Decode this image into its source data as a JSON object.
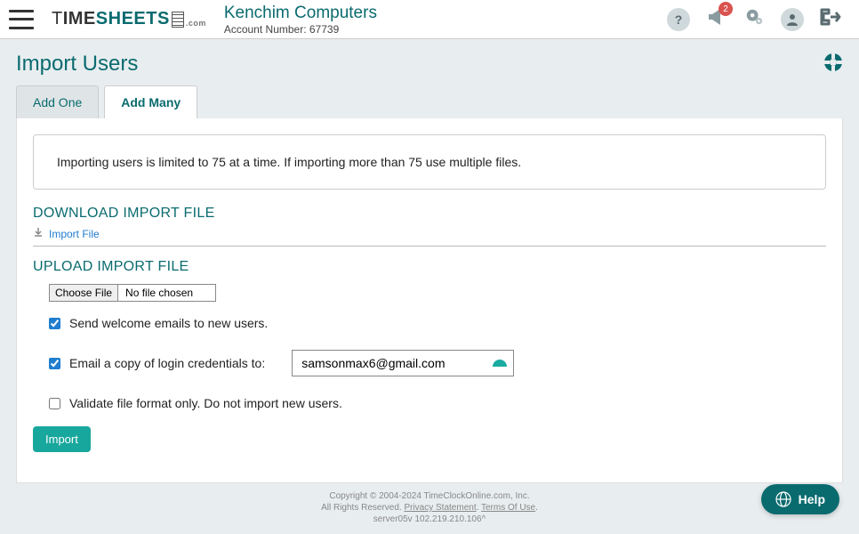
{
  "header": {
    "logo_thin": "T",
    "logo_rest": "IME",
    "logo_sheets": "SHEETS",
    "logo_dotcom": ".com",
    "company_name": "Kenchim Computers",
    "account_prefix": "Account Number: ",
    "account_number": "67739",
    "notification_count": "2"
  },
  "page": {
    "title": "Import Users"
  },
  "tabs": {
    "add_one": "Add One",
    "add_many": "Add Many"
  },
  "info": {
    "text": "Importing users is limited to 75 at a time. If importing more than 75 use multiple files."
  },
  "download": {
    "title": "DOWNLOAD IMPORT FILE",
    "link": "Import File"
  },
  "upload": {
    "title": "UPLOAD IMPORT FILE",
    "choose_file": "Choose File",
    "no_file": "No file chosen",
    "send_welcome": "Send welcome emails to new users.",
    "email_copy": "Email a copy of login credentials to:",
    "email_value": "samsonmax6@gmail.com",
    "validate_only": "Validate file format only. Do not import new users.",
    "import_btn": "Import"
  },
  "footer": {
    "line1": "Copyright © 2004-2024 TimeClockOnline.com, Inc.",
    "rights": "All Rights Reserved. ",
    "privacy": "Privacy Statement",
    "sep": ". ",
    "terms": "Terms Of Use",
    "end": ".",
    "server": "server05v 102.219.210.106^"
  },
  "help": {
    "label": "Help"
  }
}
